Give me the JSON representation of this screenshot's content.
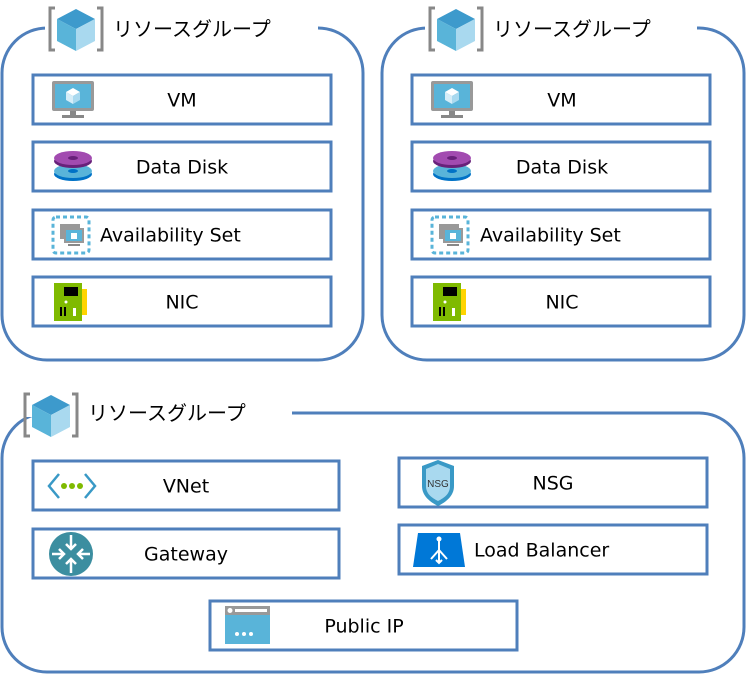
{
  "colors": {
    "border": "#4f7fbb",
    "text": "#000000"
  },
  "groups": [
    {
      "label": "リソースグループ",
      "icon": "resource-group-icon",
      "items": [
        {
          "label": "VM",
          "icon": "vm-icon"
        },
        {
          "label": "Data Disk",
          "icon": "disk-icon"
        },
        {
          "label": "Availability Set",
          "icon": "availability-set-icon"
        },
        {
          "label": "NIC",
          "icon": "nic-icon"
        }
      ]
    },
    {
      "label": "リソースグループ",
      "icon": "resource-group-icon",
      "items": [
        {
          "label": "VM",
          "icon": "vm-icon"
        },
        {
          "label": "Data Disk",
          "icon": "disk-icon"
        },
        {
          "label": "Availability Set",
          "icon": "availability-set-icon"
        },
        {
          "label": "NIC",
          "icon": "nic-icon"
        }
      ]
    },
    {
      "label": "リソースグループ",
      "icon": "resource-group-icon",
      "items": [
        {
          "label": "VNet",
          "icon": "vnet-icon"
        },
        {
          "label": "Gateway",
          "icon": "gateway-icon"
        },
        {
          "label": "NSG",
          "icon": "nsg-icon"
        },
        {
          "label": "Load Balancer",
          "icon": "load-balancer-icon"
        },
        {
          "label": "Public IP",
          "icon": "public-ip-icon"
        }
      ]
    }
  ]
}
